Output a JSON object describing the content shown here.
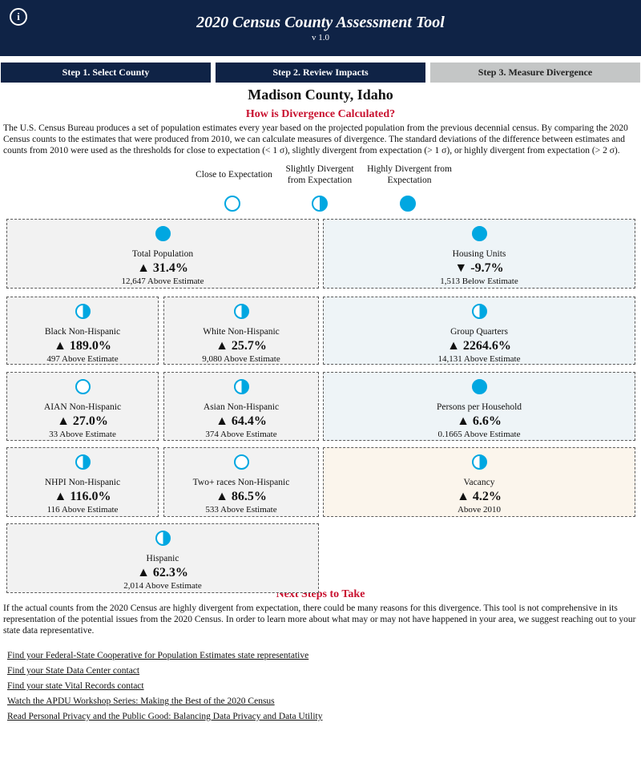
{
  "app": {
    "title": "2020 Census County Assessment Tool",
    "version": "v 1.0"
  },
  "steps": [
    "Step 1. Select County",
    "Step 2. Review Impacts",
    "Step 3. Measure Divergence"
  ],
  "county": "Madison County, Idaho",
  "calc": {
    "title": "How is Divergence Calculated?",
    "text": "The U.S. Census Bureau produces a set of population estimates every year based on the projected population from the previous decennial census. By comparing the 2020 Census counts to the estimates that were produced from 2010, we can calculate measures of divergence. The standard deviations of the difference between estimates and counts from 2010 were used as the thresholds for close to expectation (< 1 σ), slightly divergent from expectation (> 1 σ), or highly divergent from expectation (> 2 σ)."
  },
  "legend": {
    "close": "Close to Expectation",
    "slight": "Slightly Divergent from Expectation",
    "high": "Highly Divergent from Expectation"
  },
  "cards": [
    {
      "name": "Total Population",
      "value": "▲ 31.4%",
      "sub": "12,647 Above Estimate",
      "level": "full"
    },
    {
      "name": "Housing Units",
      "value": "▼ -9.7%",
      "sub": "1,513 Below Estimate",
      "level": "full"
    },
    {
      "name": "Black Non-Hispanic",
      "value": "▲ 189.0%",
      "sub": "497 Above Estimate",
      "level": "half"
    },
    {
      "name": "White Non-Hispanic",
      "value": "▲ 25.7%",
      "sub": "9,080 Above Estimate",
      "level": "half"
    },
    {
      "name": "Group Quarters",
      "value": "▲ 2264.6%",
      "sub": "14,131 Above Estimate",
      "level": "half"
    },
    {
      "name": "AIAN Non-Hispanic",
      "value": "▲ 27.0%",
      "sub": "33 Above Estimate",
      "level": "empty"
    },
    {
      "name": "Asian Non-Hispanic",
      "value": "▲ 64.4%",
      "sub": "374 Above Estimate",
      "level": "half"
    },
    {
      "name": "Persons per Household",
      "value": "▲ 6.6%",
      "sub": "0.1665 Above Estimate",
      "level": "full"
    },
    {
      "name": "NHPI Non-Hispanic",
      "value": "▲ 116.0%",
      "sub": "116 Above Estimate",
      "level": "half"
    },
    {
      "name": "Two+ races Non-Hispanic",
      "value": "▲ 86.5%",
      "sub": "533 Above Estimate",
      "level": "empty"
    },
    {
      "name": "Vacancy",
      "value": "▲ 4.2%",
      "sub": "Above 2010",
      "level": "half"
    },
    {
      "name": "Hispanic",
      "value": "▲ 62.3%",
      "sub": "2,014 Above Estimate",
      "level": "half"
    }
  ],
  "next": {
    "title": "Next Steps to Take",
    "text": "If the actual counts from the 2020 Census are highly divergent from expectation, there could be many reasons for this divergence. This tool is not comprehensive in its representation of the potential issues from the 2020 Census. In order to learn more about what may or may not have happened in your area, we suggest reaching out to your state data representative."
  },
  "links": [
    "Find your Federal-State Cooperative for Population Estimates state representative",
    "Find your State Data Center contact",
    "Find your state Vital Records contact",
    "Watch the APDU Workshop Series: Making the Best of the 2020 Census",
    "Read Personal Privacy and the Public Good: Balancing Data Privacy and Data Utility"
  ],
  "colors": {
    "navy": "#0f2346",
    "accent": "#00a7e1",
    "red": "#c8102e",
    "inactive": "#c4c6c6"
  }
}
